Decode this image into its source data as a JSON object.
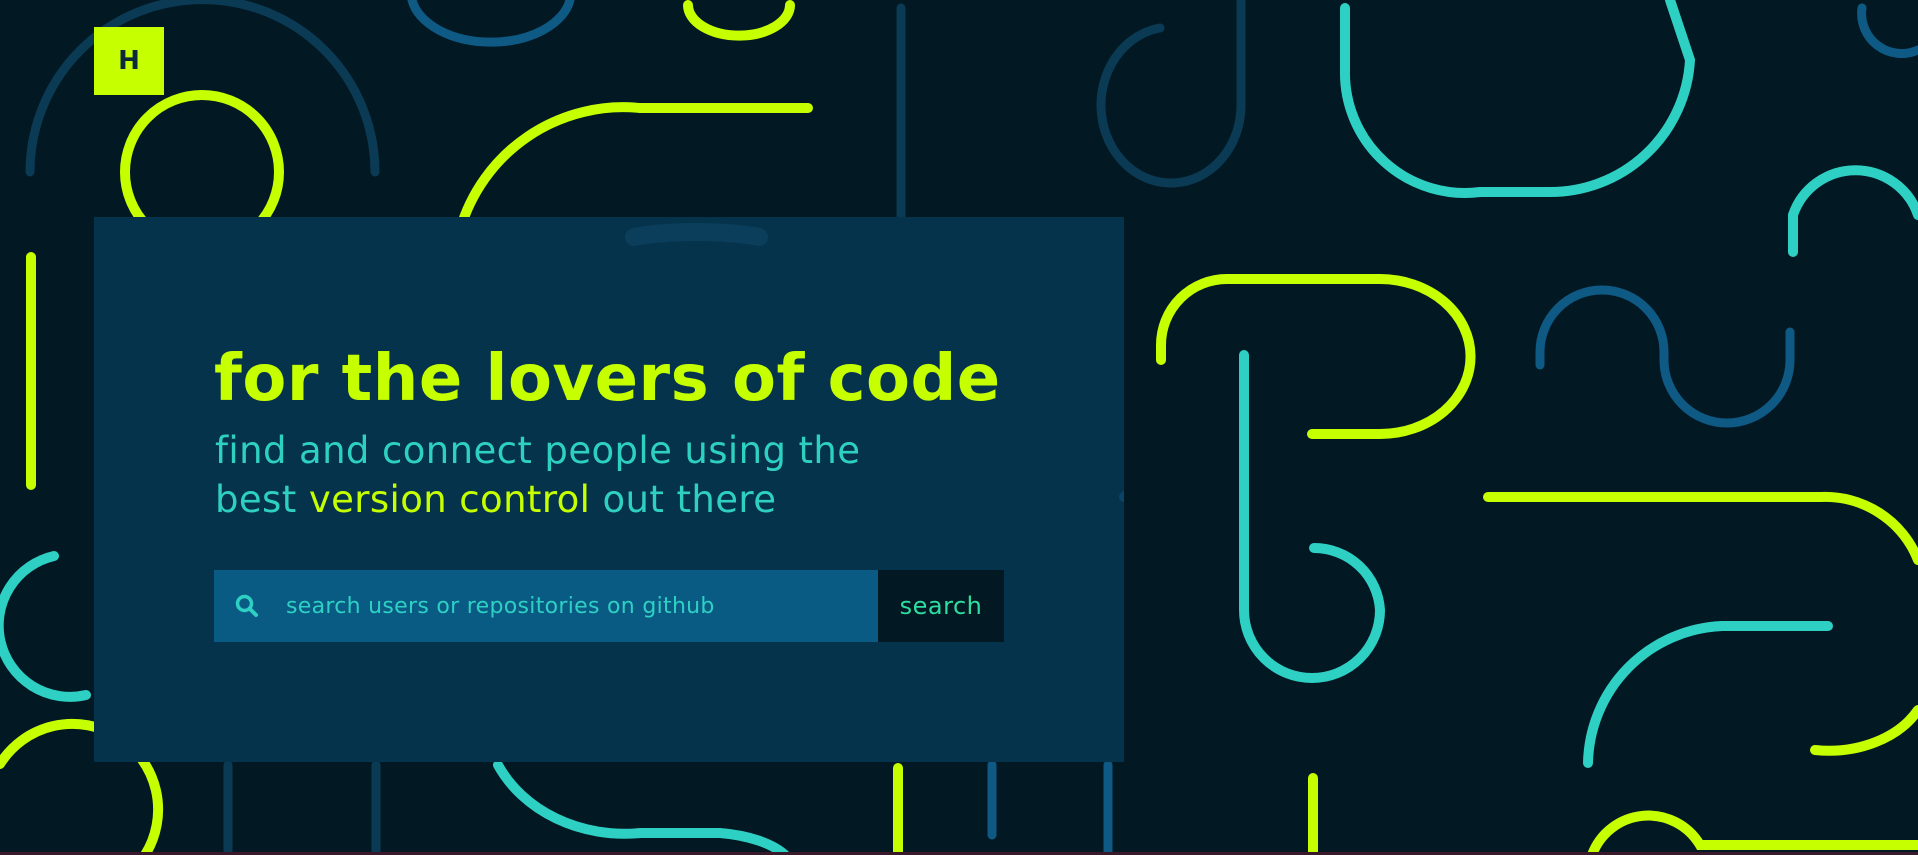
{
  "logo": {
    "letter": "H"
  },
  "hero": {
    "headline": "for the lovers of code",
    "subtitle_part1": "find and connect people using the",
    "subtitle_part2": "best",
    "subtitle_part3": "version control",
    "subtitle_part4": "out there"
  },
  "search": {
    "placeholder": "search users or repositories on github",
    "value": "",
    "button_label": "search",
    "icon": "search-icon"
  },
  "colors": {
    "background": "#021823",
    "card": "#06334c",
    "lime": "#c6ff00",
    "teal": "#2ed0c4",
    "blue": "#0a5b84",
    "dark_blue": "#0b4468"
  }
}
